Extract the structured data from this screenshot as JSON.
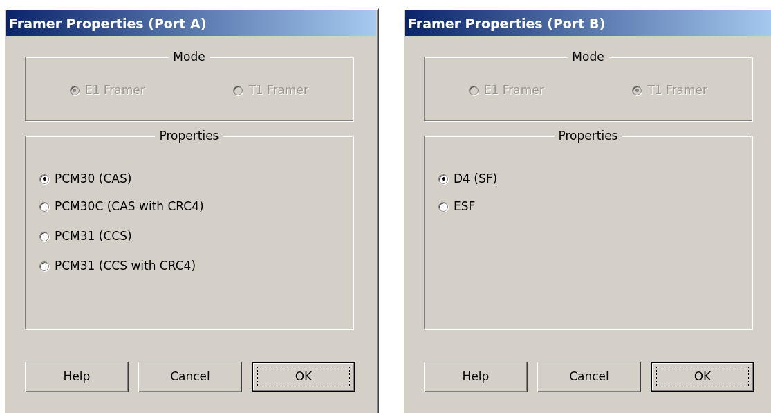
{
  "dialogs": [
    {
      "title": "Framer Properties (Port A)",
      "mode": {
        "label": "Mode",
        "options": [
          {
            "label": "E1 Framer",
            "selected": true,
            "disabled": true
          },
          {
            "label": "T1 Framer",
            "selected": false,
            "disabled": true
          }
        ]
      },
      "properties": {
        "label": "Properties",
        "options": [
          {
            "label": "PCM30 (CAS)",
            "selected": true,
            "disabled": false
          },
          {
            "label": "PCM30C (CAS with CRC4)",
            "selected": false,
            "disabled": false
          },
          {
            "label": "PCM31 (CCS)",
            "selected": false,
            "disabled": false
          },
          {
            "label": "PCM31 (CCS with CRC4)",
            "selected": false,
            "disabled": false
          }
        ]
      },
      "buttons": [
        {
          "label": "Help",
          "default": false
        },
        {
          "label": "Cancel",
          "default": false
        },
        {
          "label": "OK",
          "default": true
        }
      ]
    },
    {
      "title": "Framer Properties (Port B)",
      "mode": {
        "label": "Mode",
        "options": [
          {
            "label": "E1 Framer",
            "selected": false,
            "disabled": true
          },
          {
            "label": "T1 Framer",
            "selected": true,
            "disabled": true
          }
        ]
      },
      "properties": {
        "label": "Properties",
        "options": [
          {
            "label": "D4 (SF)",
            "selected": true,
            "disabled": false
          },
          {
            "label": "ESF",
            "selected": false,
            "disabled": false
          }
        ]
      },
      "buttons": [
        {
          "label": "Help",
          "default": false
        },
        {
          "label": "Cancel",
          "default": false
        },
        {
          "label": "OK",
          "default": true
        }
      ]
    }
  ]
}
